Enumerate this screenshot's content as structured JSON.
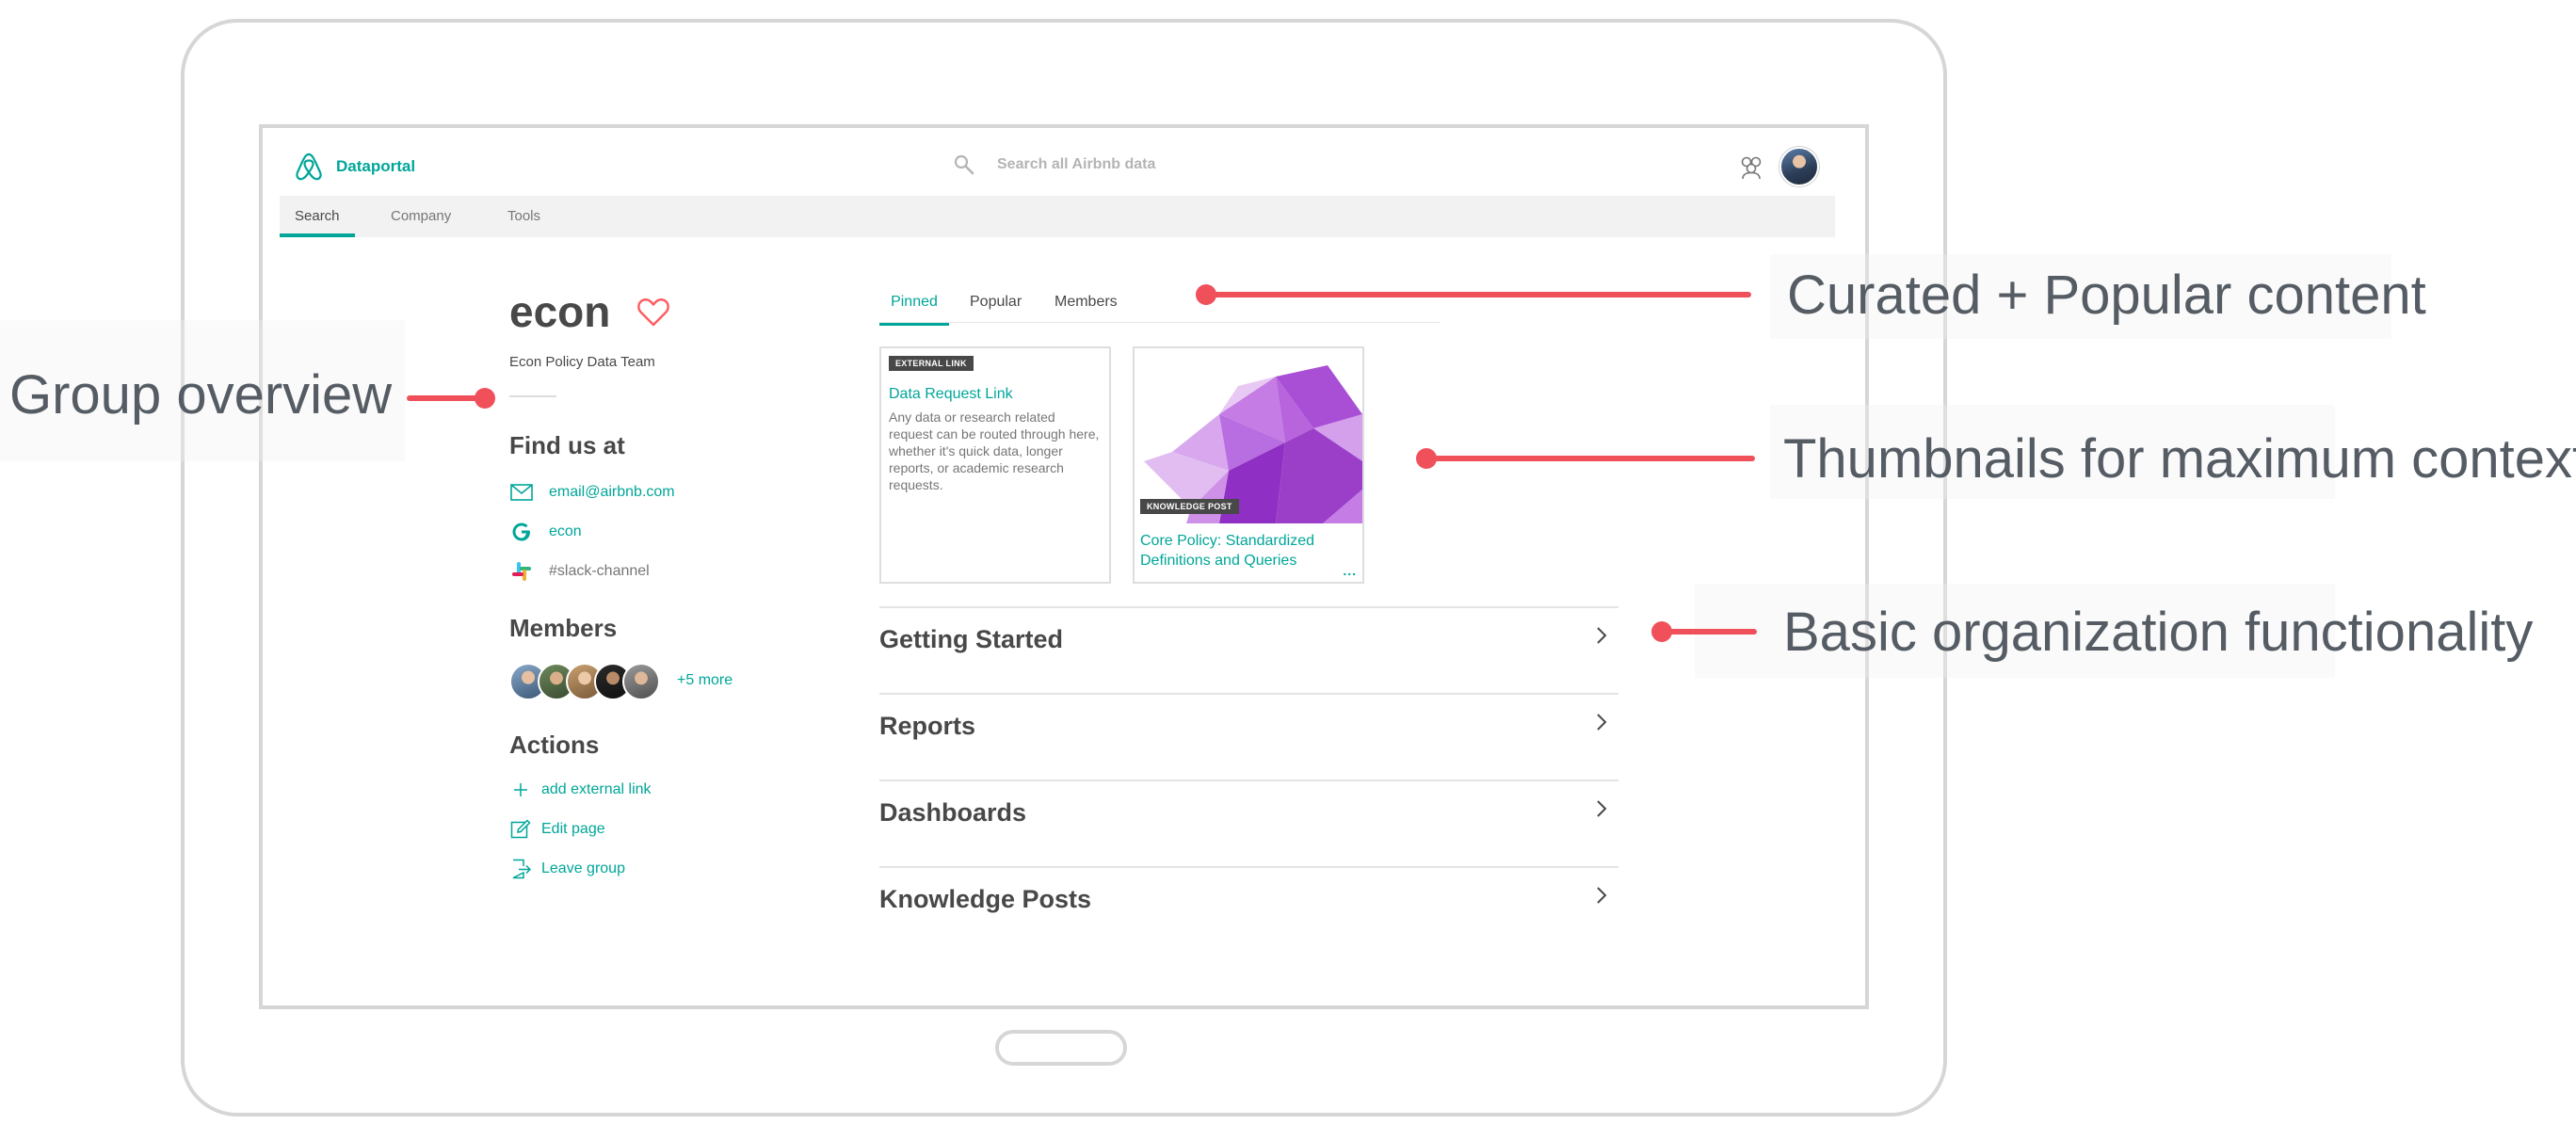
{
  "header": {
    "brand": "Dataportal",
    "search_placeholder": "Search all Airbnb data"
  },
  "nav": {
    "tabs": [
      {
        "label": "Search",
        "active": true
      },
      {
        "label": "Company",
        "active": false
      },
      {
        "label": "Tools",
        "active": false
      }
    ]
  },
  "group": {
    "name": "econ",
    "subtitle": "Econ Policy Data Team"
  },
  "find_us": {
    "heading": "Find us at",
    "email": "email@airbnb.com",
    "google_group": "econ",
    "slack": "#slack-channel"
  },
  "members": {
    "heading": "Members",
    "more": "+5 more"
  },
  "actions": {
    "heading": "Actions",
    "items": [
      {
        "label": "add external link",
        "icon": "plus-icon"
      },
      {
        "label": "Edit page",
        "icon": "edit-icon"
      },
      {
        "label": "Leave group",
        "icon": "leave-icon"
      }
    ]
  },
  "content_tabs": [
    {
      "label": "Pinned",
      "active": true
    },
    {
      "label": "Popular",
      "active": false
    },
    {
      "label": "Members",
      "active": false
    }
  ],
  "cards": [
    {
      "tag": "EXTERNAL LINK",
      "title": "Data Request Link",
      "description": "Any data or research related request can be routed through here, whether it's quick data, longer reports, or academic research requests."
    },
    {
      "tag": "KNOWLEDGE POST",
      "title": "Core Policy: Standardized Definitions and Queries",
      "more": "..."
    }
  ],
  "sections": [
    "Getting Started",
    "Reports",
    "Dashboards",
    "Knowledge Posts"
  ],
  "annotations": {
    "curated": "Curated + Popular content",
    "group_overview": "Group overview",
    "thumbnails": "Thumbnails for maximum context",
    "organization": "Basic organization functionality"
  },
  "colors": {
    "accent": "#00a699",
    "annotation_red": "#f0505a",
    "heart": "#ff5a5f",
    "thumbnail_purple": "#9b3fc9"
  }
}
